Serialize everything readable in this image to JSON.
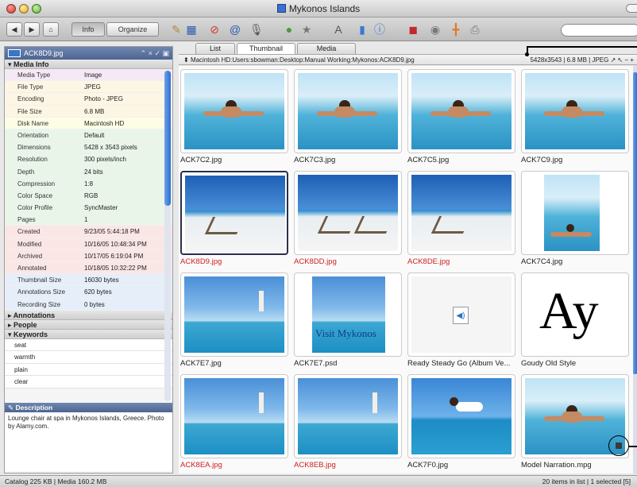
{
  "window": {
    "title": "Mykonos Islands"
  },
  "toolbar": {
    "info_label": "Info",
    "organize_label": "Organize"
  },
  "info_panel": {
    "header_file": "ACK8D9.jpg",
    "header_controls": "⌃ × ✓ ▣",
    "section_media_info": "Media Info",
    "rows": [
      {
        "key": "Media Type",
        "value": "Image",
        "bg": "#f6e9f6"
      },
      {
        "key": "File Type",
        "value": "JPEG",
        "bg": "#fdf6e4"
      },
      {
        "key": "Encoding",
        "value": "Photo - JPEG",
        "bg": "#fdf6e4"
      },
      {
        "key": "File Size",
        "value": "6.8  MB",
        "bg": "#fdf6e4"
      },
      {
        "key": "Disk Name",
        "value": "Macintosh HD",
        "bg": "#fdfde6"
      },
      {
        "key": "Orientation",
        "value": "Default",
        "bg": "#e9f5e9"
      },
      {
        "key": "Dimensions",
        "value": "5428 x 3543 pixels",
        "bg": "#e9f5e9"
      },
      {
        "key": "Resolution",
        "value": "300 pixels/inch",
        "bg": "#e9f5e9"
      },
      {
        "key": "Depth",
        "value": "24 bits",
        "bg": "#e9f5e9"
      },
      {
        "key": "Compression",
        "value": "1:8",
        "bg": "#e9f5e9"
      },
      {
        "key": "Color Space",
        "value": "RGB",
        "bg": "#e9f5e9"
      },
      {
        "key": "Color Profile",
        "value": "SyncMaster",
        "bg": "#e9f5e9"
      },
      {
        "key": "Pages",
        "value": "1",
        "bg": "#e9f5e9"
      },
      {
        "key": "Created",
        "value": "9/23/05 5:44:18 PM",
        "bg": "#fbe6e6"
      },
      {
        "key": "Modified",
        "value": "10/16/05 10:48:34 PM",
        "bg": "#fbe6e6"
      },
      {
        "key": "Archived",
        "value": "10/17/05 6:19:04 PM",
        "bg": "#fbe6e6"
      },
      {
        "key": "Annotated",
        "value": "10/18/05 10:32:22 PM",
        "bg": "#fbe6e6"
      },
      {
        "key": "Thumbnail Size",
        "value": "16030 bytes",
        "bg": "#e6eef9"
      },
      {
        "key": "Annotations Size",
        "value": "620 bytes",
        "bg": "#e6eef9"
      },
      {
        "key": "Recording Size",
        "value": "0 bytes",
        "bg": "#e6eef9"
      }
    ],
    "section_annotations": "Annotations",
    "section_people": "People",
    "section_keywords": "Keywords",
    "keywords": [
      "seat",
      "warmth",
      "plain",
      "clear"
    ],
    "description_label": "Description",
    "description_text": "Lounge chair at spa in Mykonos Islands, Greece. Photo by Alamy.com."
  },
  "tabs": [
    "List",
    "Thumbnail",
    "Media"
  ],
  "path": {
    "text": "Macintosh HD:Users:sbowman:Desktop:Manual Working:Mykonos:ACK8D9.jpg",
    "meta": "5428x3543  |  6.8 MB  |  JPEG"
  },
  "thumbnails": [
    {
      "name": "ACK7C2.jpg",
      "red": false,
      "kind": "woman"
    },
    {
      "name": "ACK7C3.jpg",
      "red": false,
      "kind": "woman"
    },
    {
      "name": "ACK7C5.jpg",
      "red": false,
      "kind": "woman"
    },
    {
      "name": "ACK7C9.jpg",
      "red": false,
      "kind": "woman"
    },
    {
      "name": "ACK8D9.jpg",
      "red": true,
      "kind": "chair",
      "selected": true
    },
    {
      "name": "ACK8DD.jpg",
      "red": true,
      "kind": "chairs"
    },
    {
      "name": "ACK8DE.jpg",
      "red": true,
      "kind": "chair"
    },
    {
      "name": "ACK7C4.jpg",
      "red": false,
      "kind": "woman-portrait"
    },
    {
      "name": "ACK7E7.jpg",
      "red": false,
      "kind": "pool"
    },
    {
      "name": "ACK7E7.psd",
      "red": false,
      "kind": "poster",
      "poster_text": "Visit Mykonos"
    },
    {
      "name": "Ready Steady Go (Album Ve...",
      "red": false,
      "kind": "audio"
    },
    {
      "name": "Goudy Old Style",
      "red": false,
      "kind": "font",
      "font_sample": "Ay"
    },
    {
      "name": "ACK8EA.jpg",
      "red": true,
      "kind": "pool"
    },
    {
      "name": "ACK8EB.jpg",
      "red": true,
      "kind": "pool"
    },
    {
      "name": "ACK7F0.jpg",
      "red": false,
      "kind": "woman-side"
    },
    {
      "name": "Model Narration.mpg",
      "red": false,
      "kind": "woman-edge"
    }
  ],
  "status": {
    "left": "Catalog  225 KB  |  Media 160.2 MB",
    "right": "20 items in list  |  1 selected [5]"
  }
}
